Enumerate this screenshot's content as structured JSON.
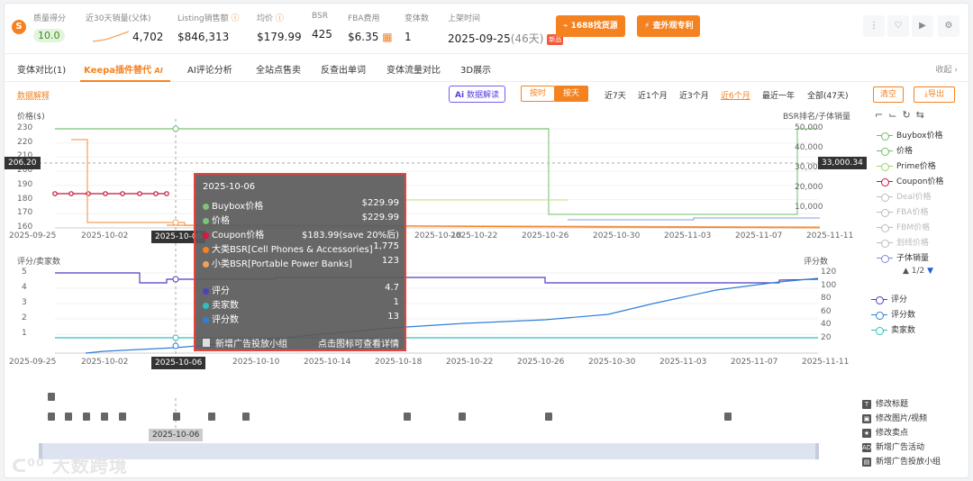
{
  "header": {
    "quality": {
      "label": "质量得分",
      "value": "10.0"
    },
    "sales30": {
      "label": "近30天销量(父体)",
      "value": "4,702"
    },
    "listing_sales": {
      "label": "Listing销售额",
      "value": "$846,313"
    },
    "avg_price": {
      "label": "均价",
      "value": "$179.99"
    },
    "bsr": {
      "label": "BSR",
      "value": "425"
    },
    "fba": {
      "label": "FBA费用",
      "value": "$6.35"
    },
    "variants": {
      "label": "变体数",
      "value": "1"
    },
    "listed": {
      "label": "上架时间",
      "value": "2025-09-25",
      "days": "(46天)",
      "tag": "新品"
    },
    "btn_1688": "1688找货源",
    "btn_patent": "查外观专利"
  },
  "tabs": [
    "变体对比(1)",
    "Keepa插件替代",
    "AI评论分析",
    "全站点售卖",
    "反查出单词",
    "变体流量对比",
    "3D展示"
  ],
  "tab_ai": "AI",
  "collapse": "收起",
  "controls": {
    "data_explain": "数据解释",
    "ai_btn": "数据解读",
    "by_hour": "按时",
    "by_day": "按天",
    "ranges": [
      "近7天",
      "近1个月",
      "近3个月",
      "近6个月",
      "最近一年",
      "全部(47天)"
    ],
    "clear": "清空",
    "export": "导出"
  },
  "top_chart": {
    "ylabel_left": "价格($)",
    "ylabel_right": "BSR排名/子体销量",
    "yticks_left": [
      "230",
      "220",
      "210",
      "200",
      "190",
      "180",
      "170",
      "160"
    ],
    "yticks_right": [
      "50,000",
      "40,000",
      "30,000",
      "20,000",
      "10,000"
    ],
    "xticks": [
      "2025-09-25",
      "2025-10-02",
      "2025-10-06",
      "2025-10-18",
      "2025-10-22",
      "2025-10-26",
      "2025-10-30",
      "2025-11-03",
      "2025-11-07",
      "2025-11-11"
    ],
    "crosshair_left": "206.20",
    "crosshair_right": "33,000.34"
  },
  "bottom_chart": {
    "ylabel_left": "评分/卖家数",
    "ylabel_right": "评分数",
    "yticks_left": [
      "5",
      "4",
      "3",
      "2",
      "1"
    ],
    "yticks_right": [
      "120",
      "100",
      "80",
      "60",
      "40",
      "20"
    ],
    "xticks": [
      "2025-09-25",
      "2025-10-02",
      "2025-10-06",
      "2025-10-10",
      "2025-10-14",
      "2025-10-18",
      "2025-10-22",
      "2025-10-26",
      "2025-10-30",
      "2025-11-03",
      "2025-11-07",
      "2025-11-11"
    ]
  },
  "legend_top": [
    {
      "name": "Buybox价格",
      "color": "#6cbf6a",
      "dim": false
    },
    {
      "name": "价格",
      "color": "#6cbf6a",
      "dim": false
    },
    {
      "name": "Prime价格",
      "color": "#9ed36a",
      "dim": false
    },
    {
      "name": "Coupon价格",
      "color": "#c0143c",
      "dim": false
    },
    {
      "name": "Deal价格",
      "color": "#bbb",
      "dim": true
    },
    {
      "name": "FBA价格",
      "color": "#bbb",
      "dim": true
    },
    {
      "name": "FBM价格",
      "color": "#bbb",
      "dim": true
    },
    {
      "name": "划线价格",
      "color": "#bbb",
      "dim": true
    },
    {
      "name": "子体销量",
      "color": "#7a8ad8",
      "dim": false
    }
  ],
  "legend_page": "1/2",
  "legend_bottom": [
    {
      "name": "评分",
      "color": "#4b3fc4"
    },
    {
      "name": "评分数",
      "color": "#2f7fd8"
    },
    {
      "name": "卖家数",
      "color": "#2fbfbf"
    }
  ],
  "tooltip": {
    "date": "2025-10-06",
    "rows": [
      {
        "label": "Buybox价格",
        "value": "$229.99",
        "color": "#7cc47a"
      },
      {
        "label": "价格",
        "value": "$229.99",
        "color": "#7cc47a"
      },
      {
        "label": "Coupon价格",
        "value": "$183.99(save 20%后)",
        "color": "#e0143c"
      },
      {
        "label": "大类BSR[Cell Phones & Accessories]",
        "value": "1,775",
        "color": "#f58220"
      },
      {
        "label": "小类BSR[Portable Power Banks]",
        "value": "123",
        "color": "#f5a05a"
      },
      {
        "label": "评分",
        "value": "4.7",
        "color": "#4b3fc4"
      },
      {
        "label": "卖家数",
        "value": "1",
        "color": "#2fbfbf"
      },
      {
        "label": "评分数",
        "value": "13",
        "color": "#2f7fd8"
      }
    ],
    "footer_left": "新增广告投放小组",
    "footer_right": "点击图标可查看详情"
  },
  "event_date": "2025-10-06",
  "events_legend": [
    "修改标题",
    "修改图片/视频",
    "修改卖点",
    "新增广告活动",
    "新增广告投放小组"
  ],
  "watermark": "大数跨境"
}
